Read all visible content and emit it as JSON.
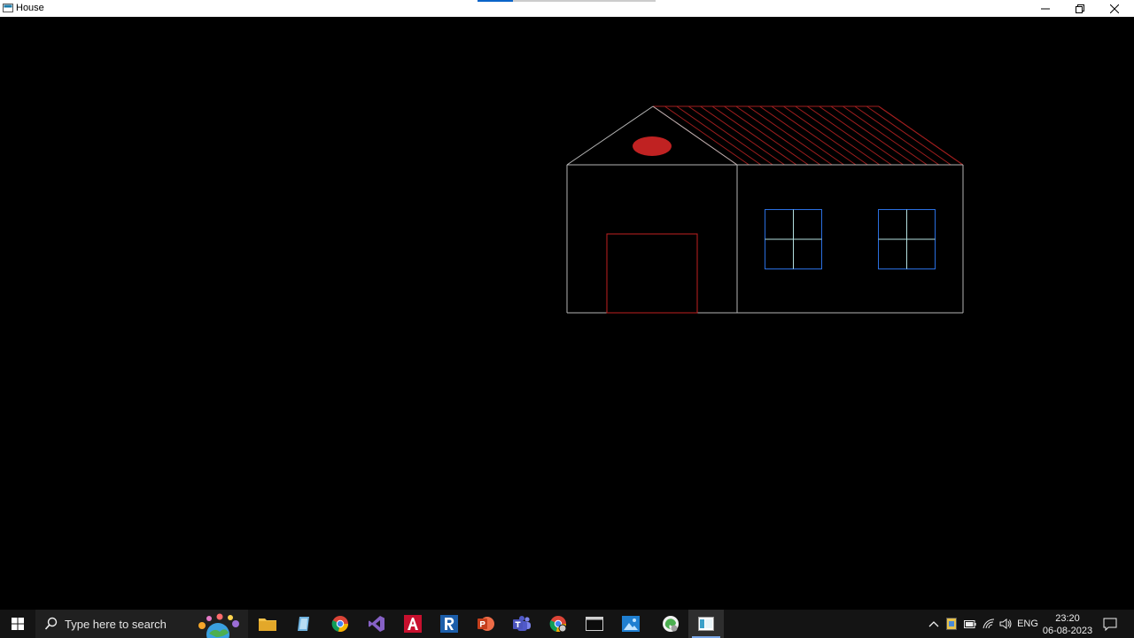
{
  "window": {
    "title": "House",
    "progress_fraction": 0.2
  },
  "icons": {
    "app": "app-icon",
    "minimize": "minimize-icon",
    "maximize": "restore-icon",
    "close": "close-icon",
    "start": "windows-logo-icon",
    "search": "search-icon",
    "tray_chevron": "chevron-up-icon",
    "notification": "notification-icon"
  },
  "taskbar": {
    "search_placeholder": "Type here to search",
    "apps": [
      {
        "name": "file-explorer",
        "icon": "folder-icon"
      },
      {
        "name": "notepad-like",
        "icon": "notepad-icon"
      },
      {
        "name": "chrome",
        "icon": "chrome-icon"
      },
      {
        "name": "visual-studio",
        "icon": "visual-studio-icon"
      },
      {
        "name": "autocad",
        "icon": "autocad-icon"
      },
      {
        "name": "revit",
        "icon": "revit-icon"
      },
      {
        "name": "powerpoint",
        "icon": "powerpoint-icon"
      },
      {
        "name": "teams",
        "icon": "teams-icon"
      },
      {
        "name": "chrome-2",
        "icon": "chrome-icon"
      },
      {
        "name": "terminal",
        "icon": "terminal-icon"
      },
      {
        "name": "photos",
        "icon": "photos-icon"
      },
      {
        "name": "edge",
        "icon": "edge-icon"
      },
      {
        "name": "house-app",
        "icon": "window-app-icon",
        "active": true
      }
    ],
    "language": "ENG",
    "time": "23:20",
    "date": "06-08-2023"
  },
  "colors": {
    "outline": "#b4b4b4",
    "roof_hatch": "#a01e1e",
    "door": "#c02020",
    "chimney": "#c02222",
    "window_frame": "#2a6fe0",
    "window_cross": "#b4e0e0"
  }
}
